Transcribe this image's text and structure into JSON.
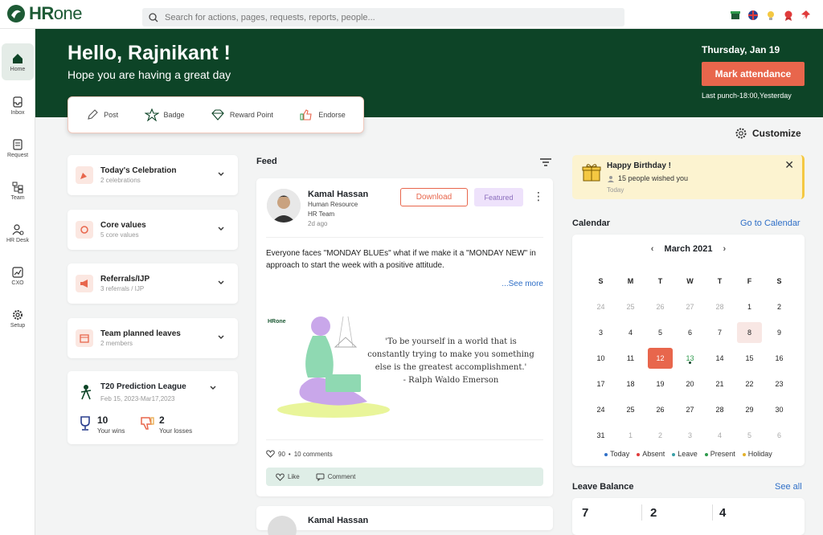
{
  "brand": {
    "name_bold": "HR",
    "name_rest": "one",
    "color": "#1d5a35"
  },
  "search": {
    "placeholder": "Search for actions, pages, requests, reports, people..."
  },
  "sidebar": {
    "items": [
      {
        "label": "Home",
        "icon": "home-icon"
      },
      {
        "label": "Inbox",
        "icon": "inbox-icon"
      },
      {
        "label": "Request",
        "icon": "request-icon"
      },
      {
        "label": "Team",
        "icon": "team-icon"
      },
      {
        "label": "HR Desk",
        "icon": "hr-desk-icon"
      },
      {
        "label": "CXO",
        "icon": "chart-icon"
      },
      {
        "label": "Setup",
        "icon": "gear-icon"
      }
    ]
  },
  "hero": {
    "greeting": "Hello, Rajnikant !",
    "subtitle": "Hope you are having a great day",
    "date": "Thursday, Jan 19",
    "mark_attendance": "Mark attendance",
    "last_punch": "Last punch-18:00,Yesterday"
  },
  "quick_actions": [
    {
      "label": "Post",
      "icon": "pencil-icon"
    },
    {
      "label": "Badge",
      "icon": "badge-icon"
    },
    {
      "label": "Reward Point",
      "icon": "diamond-icon"
    },
    {
      "label": "Endorse",
      "icon": "thumbs-up-icon"
    }
  ],
  "customize": "Customize",
  "left_cards": [
    {
      "title": "Today's Celebration",
      "sub": "2 celebrations"
    },
    {
      "title": "Core values",
      "sub": "5 core values"
    },
    {
      "title": "Referrals/IJP",
      "sub": "3 referrals / IJP"
    },
    {
      "title": "Team planned leaves",
      "sub": "2 members"
    }
  ],
  "t20": {
    "title": "T20 Prediction League",
    "dates": "Feb 15, 2023-Mar17,2023",
    "wins": "10",
    "wins_label": "Your wins",
    "losses": "2",
    "losses_label": "Your losses"
  },
  "feed": {
    "label": "Feed",
    "post": {
      "name": "Kamal Hassan",
      "dept": "Human Resource",
      "team": "HR Team",
      "time": "2d ago",
      "download": "Download",
      "featured": "Featured",
      "text": "Everyone faces \"MONDAY BLUEs\" what if we make it a \"MONDAY NEW\" in approach to start the week with a positive attitude.",
      "see_more": "...See more",
      "image_brand": "HRone",
      "quote_lines": [
        "'To be yourself in a world that is",
        "constantly trying to make you something",
        "else is the greatest accomplishment.'",
        "- Ralph Waldo Emerson"
      ],
      "likes": "90",
      "comments": "10 comments",
      "like_label": "Like",
      "comment_label": "Comment"
    },
    "post2_name": "Kamal Hassan"
  },
  "birthday": {
    "title": "Happy Birthday !",
    "wishes": "15 people wished you",
    "when": "Today"
  },
  "calendar": {
    "label": "Calendar",
    "go": "Go to Calendar",
    "month": "March  2021",
    "dow": [
      "S",
      "M",
      "T",
      "W",
      "T",
      "F",
      "S"
    ],
    "days": [
      [
        "24",
        "m"
      ],
      [
        "25",
        "m"
      ],
      [
        "26",
        "m"
      ],
      [
        "27",
        "m"
      ],
      [
        "28",
        "m"
      ],
      [
        "1",
        ""
      ],
      [
        "2",
        ""
      ],
      [
        "3",
        ""
      ],
      [
        "4",
        ""
      ],
      [
        "5",
        ""
      ],
      [
        "6",
        ""
      ],
      [
        "7",
        ""
      ],
      [
        "8",
        "hl"
      ],
      [
        "9",
        ""
      ],
      [
        "10",
        ""
      ],
      [
        "11",
        ""
      ],
      [
        "12",
        "sel"
      ],
      [
        "13",
        "present"
      ],
      [
        "14",
        ""
      ],
      [
        "15",
        ""
      ],
      [
        "16",
        ""
      ],
      [
        "17",
        ""
      ],
      [
        "18",
        ""
      ],
      [
        "19",
        ""
      ],
      [
        "20",
        ""
      ],
      [
        "21",
        ""
      ],
      [
        "22",
        ""
      ],
      [
        "23",
        ""
      ],
      [
        "24",
        ""
      ],
      [
        "25",
        ""
      ],
      [
        "26",
        ""
      ],
      [
        "27",
        ""
      ],
      [
        "28",
        ""
      ],
      [
        "29",
        ""
      ],
      [
        "30",
        ""
      ],
      [
        "31",
        ""
      ],
      [
        "1",
        "m"
      ],
      [
        "2",
        "m"
      ],
      [
        "3",
        "m"
      ],
      [
        "4",
        "m"
      ],
      [
        "5",
        "m"
      ],
      [
        "6",
        "m"
      ]
    ],
    "legend": [
      {
        "label": "Today",
        "color": "#2f6fc7"
      },
      {
        "label": "Absent",
        "color": "#e03b3b"
      },
      {
        "label": "Leave",
        "color": "#3aa0a8"
      },
      {
        "label": "Present",
        "color": "#2e9a4c"
      },
      {
        "label": "Holiday",
        "color": "#e3b12b"
      }
    ]
  },
  "leave_balance": {
    "label": "Leave Balance",
    "see_all": "See all",
    "values": [
      "7",
      "2",
      "4"
    ]
  },
  "colors": {
    "hero": "#0d4427",
    "accent": "#e8664c",
    "link": "#2f6fc7"
  }
}
